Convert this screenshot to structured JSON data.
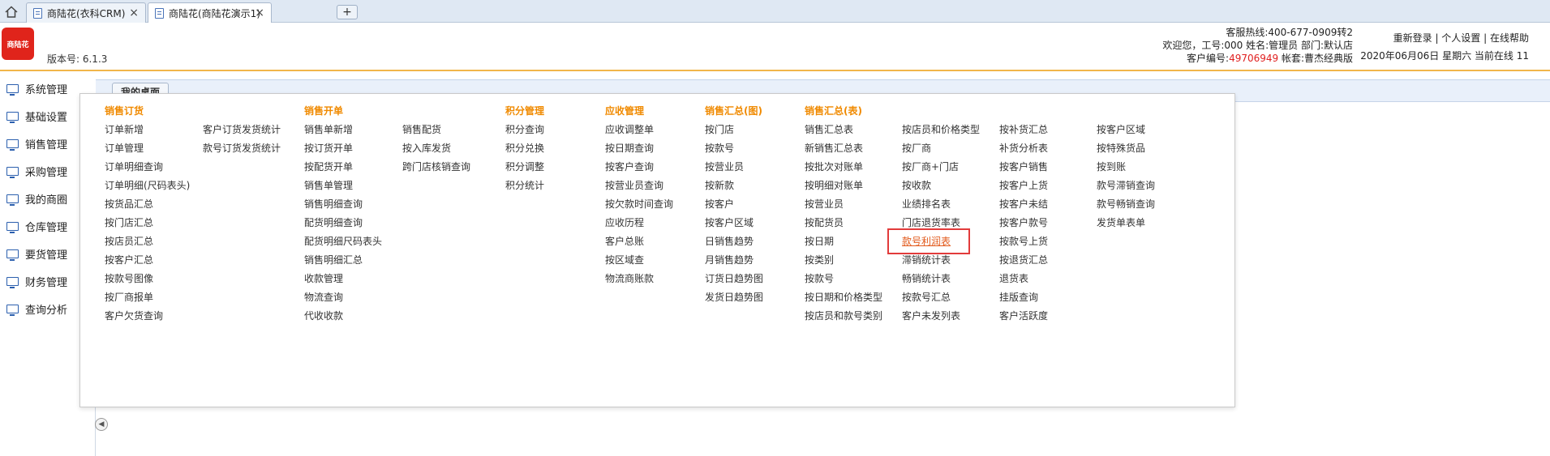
{
  "browser": {
    "tabs": [
      {
        "label": "商陆花(衣科CRM)"
      },
      {
        "label": "商陆花(商陆花演示1)"
      }
    ],
    "new_tab_label": "+",
    "close_glyph": "×"
  },
  "header": {
    "logo_text": "商陆花",
    "version": "版本号: 6.1.3",
    "hotline": "客服热线:400-677-0909转2",
    "welcome": "欢迎您，工号:000 姓名:管理员 部门:默认店",
    "customer_prefix": "客户编号:",
    "customer_id": "49706949",
    "package": " 帐套:曹杰经典版",
    "links": {
      "relogin": "重新登录",
      "settings": "个人设置",
      "help": "在线帮助",
      "sep": " | "
    },
    "date_line": "2020年06月06日 星期六 当前在线 11"
  },
  "sidebar": {
    "items": [
      {
        "label": "系统管理"
      },
      {
        "label": "基础设置"
      },
      {
        "label": "销售管理"
      },
      {
        "label": "采购管理"
      },
      {
        "label": "我的商圈"
      },
      {
        "label": "仓库管理"
      },
      {
        "label": "要货管理"
      },
      {
        "label": "财务管理"
      },
      {
        "label": "查询分析"
      }
    ]
  },
  "content": {
    "desk_tab": "我的桌面"
  },
  "menu": {
    "columns": [
      {
        "header": "销售订货",
        "items": [
          [
            "订单新增",
            "客户订货发货统计"
          ],
          [
            "订单管理",
            "款号订货发货统计"
          ],
          [
            "订单明细查询",
            ""
          ],
          [
            "订单明细(尺码表头)",
            ""
          ],
          [
            "按货品汇总",
            ""
          ],
          [
            "按门店汇总",
            ""
          ],
          [
            "按店员汇总",
            ""
          ],
          [
            "按客户汇总",
            ""
          ],
          [
            "按款号图像",
            ""
          ],
          [
            "按厂商报单",
            ""
          ],
          [
            "客户欠货查询",
            ""
          ]
        ]
      },
      {
        "header": "销售开单",
        "items": [
          [
            "销售单新增",
            "销售配货"
          ],
          [
            "按订货开单",
            "按入库发货"
          ],
          [
            "按配货开单",
            "跨门店核销查询"
          ],
          [
            "销售单管理",
            ""
          ],
          [
            "销售明细查询",
            ""
          ],
          [
            "配货明细查询",
            ""
          ],
          [
            "配货明细尺码表头",
            ""
          ],
          [
            "销售明细汇总",
            ""
          ],
          [
            "收款管理",
            ""
          ],
          [
            "物流查询",
            ""
          ],
          [
            "代收收款",
            ""
          ]
        ]
      },
      {
        "header": "积分管理",
        "items": [
          [
            "积分查询"
          ],
          [
            "积分兑换"
          ],
          [
            "积分调整"
          ],
          [
            "积分统计"
          ]
        ]
      },
      {
        "header": "应收管理",
        "items": [
          [
            "应收调整单"
          ],
          [
            "按日期查询"
          ],
          [
            "按客户查询"
          ],
          [
            "按营业员查询"
          ],
          [
            "按欠款时间查询"
          ],
          [
            "应收历程"
          ],
          [
            "客户总账"
          ],
          [
            "按区域查"
          ],
          [
            "物流商账款"
          ]
        ]
      },
      {
        "header": "销售汇总(图)",
        "items": [
          [
            "按门店"
          ],
          [
            "按款号"
          ],
          [
            "按营业员"
          ],
          [
            "按新款"
          ],
          [
            "按客户"
          ],
          [
            "按客户区域"
          ],
          [
            "日销售趋势"
          ],
          [
            "月销售趋势"
          ],
          [
            "订货日趋势图"
          ],
          [
            "发货日趋势图"
          ]
        ]
      },
      {
        "header": "销售汇总(表)",
        "items": [
          [
            "销售汇总表",
            "按店员和价格类型",
            "按补货汇总",
            "按客户区域"
          ],
          [
            "新销售汇总表",
            "按厂商",
            "补货分析表",
            "按特殊货品"
          ],
          [
            "按批次对账单",
            "按厂商+门店",
            "按客户销售",
            "按到账"
          ],
          [
            "按明细对账单",
            "按收款",
            "按客户上货",
            "款号滞销查询"
          ],
          [
            "按营业员",
            "业绩排名表",
            "按客户未结",
            "款号畅销查询"
          ],
          [
            "按配货员",
            "门店退货率表",
            "按客户款号",
            "发货单表单"
          ],
          [
            "按日期",
            "款号利润表",
            "按款号上货",
            ""
          ],
          [
            "按类别",
            "滞销统计表",
            "按退货汇总",
            ""
          ],
          [
            "按款号",
            "畅销统计表",
            "退货表",
            ""
          ],
          [
            "按日期和价格类型",
            "按款号汇总",
            "挂版查询",
            ""
          ],
          [
            "按店员和款号类别",
            "客户未发列表",
            "客户活跃度",
            ""
          ]
        ]
      }
    ],
    "highlighted_item": "款号利润表",
    "accent_color": "#f08a00",
    "highlight_color": "#e23b3b"
  }
}
